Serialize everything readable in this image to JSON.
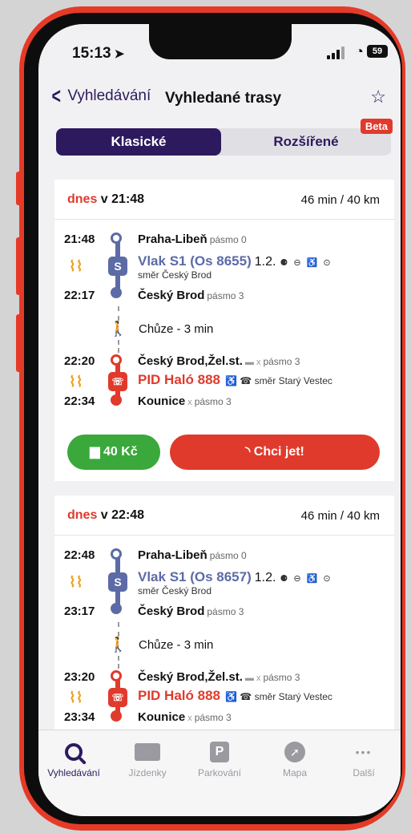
{
  "status": {
    "time": "15:13",
    "battery": "59"
  },
  "nav": {
    "back_label": "Vyhledávání",
    "title": "Vyhledané trasy"
  },
  "segment": {
    "active": "Klasické",
    "inactive": "Rozšířené",
    "badge": "Beta"
  },
  "trips": [
    {
      "when_prefix": "dnes",
      "when_time": "v 21:48",
      "duration": "46 min / 40 km",
      "dep1": "21:48",
      "stop1": "Praha-Libeň",
      "zone1": "pásmo 0",
      "train": "Vlak S1 (Os 8655)",
      "platform": "1.2.",
      "train_dir": "směr Český Brod",
      "arr1": "22:17",
      "stop2": "Český Brod",
      "zone2": "pásmo 3",
      "walk": "Chůze - 3 min",
      "dep2": "22:20",
      "stop3": "Český Brod,Žel.st.",
      "zone3": "pásmo 3",
      "bus": "PID Haló 888",
      "bus_dir": "směr Starý Vestec",
      "arr2": "22:34",
      "stop4": "Kounice",
      "zone4": "pásmo 3",
      "price": "40 Kč",
      "go": "Chci jet!"
    },
    {
      "when_prefix": "dnes",
      "when_time": "v 22:48",
      "duration": "46 min / 40 km",
      "dep1": "22:48",
      "stop1": "Praha-Libeň",
      "zone1": "pásmo 0",
      "train": "Vlak S1 (Os 8657)",
      "platform": "1.2.",
      "train_dir": "směr Český Brod",
      "arr1": "23:17",
      "stop2": "Český Brod",
      "zone2": "pásmo 3",
      "walk": "Chůze - 3 min",
      "dep2": "23:20",
      "stop3": "Český Brod,Žel.st.",
      "zone3": "pásmo 3",
      "bus": "PID Haló 888",
      "bus_dir": "směr Starý Vestec",
      "arr2": "23:34",
      "stop4": "Kounice",
      "zone4": "pásmo 3"
    }
  ],
  "tabs": [
    {
      "label": "Vyhledávání",
      "icon": "search-icon"
    },
    {
      "label": "Jízdenky",
      "icon": "ticket-icon"
    },
    {
      "label": "Parkování",
      "icon": "parking-icon",
      "glyph": "P"
    },
    {
      "label": "Mapa",
      "icon": "compass-icon"
    },
    {
      "label": "Další",
      "icon": "more-icon",
      "glyph": "•••"
    }
  ],
  "colors": {
    "brand": "#2d1a5e",
    "train": "#5c6ba6",
    "bus": "#e03a2c",
    "price": "#3aa83a",
    "frame": "#e53a28"
  }
}
